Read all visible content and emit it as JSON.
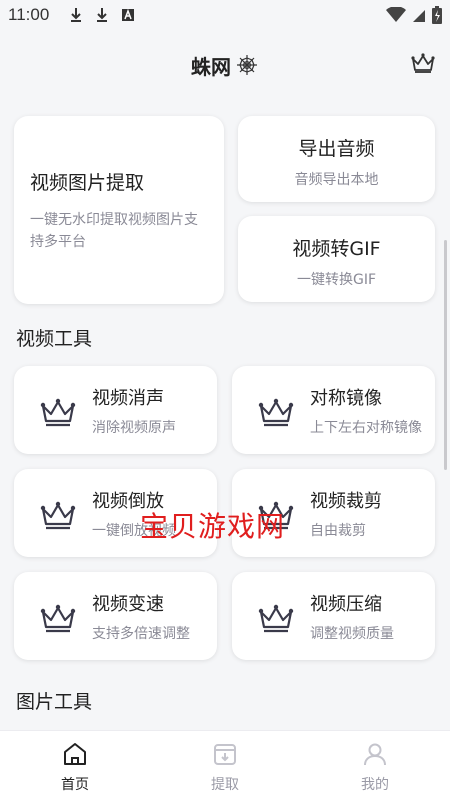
{
  "status_bar": {
    "time": "11:00"
  },
  "header": {
    "title": "蛛网",
    "vip_icon": "crown-icon"
  },
  "featured": {
    "main": {
      "title": "视频图片提取",
      "subtitle": "一键无水印提取视频图片支持多平台"
    },
    "cards": [
      {
        "title": "导出音频",
        "subtitle": "音频导出本地"
      },
      {
        "title": "视频转GIF",
        "subtitle": "一键转换GIF"
      }
    ]
  },
  "video_tools": {
    "heading": "视频工具",
    "items": [
      {
        "title": "视频消声",
        "subtitle": "消除视频原声",
        "icon": "crown-icon"
      },
      {
        "title": "对称镜像",
        "subtitle": "上下左右对称镜像",
        "icon": "crown-icon"
      },
      {
        "title": "视频倒放",
        "subtitle": "一键倒放视频",
        "icon": "crown-icon"
      },
      {
        "title": "视频裁剪",
        "subtitle": "自由裁剪",
        "icon": "crown-icon"
      },
      {
        "title": "视频变速",
        "subtitle": "支持多倍速调整",
        "icon": "crown-icon"
      },
      {
        "title": "视频压缩",
        "subtitle": "调整视频质量",
        "icon": "crown-icon"
      }
    ]
  },
  "image_tools": {
    "heading": "图片工具"
  },
  "watermark": "宝贝游戏网",
  "bottom_nav": [
    {
      "label": "首页",
      "icon": "home-icon",
      "active": true
    },
    {
      "label": "提取",
      "icon": "download-box-icon",
      "active": false
    },
    {
      "label": "我的",
      "icon": "user-icon",
      "active": false
    }
  ],
  "colors": {
    "background": "#f5f6f8",
    "card": "#ffffff",
    "subtext": "#8a8a96",
    "watermark": "#e01e1e",
    "icon": "#3a3a4a"
  }
}
